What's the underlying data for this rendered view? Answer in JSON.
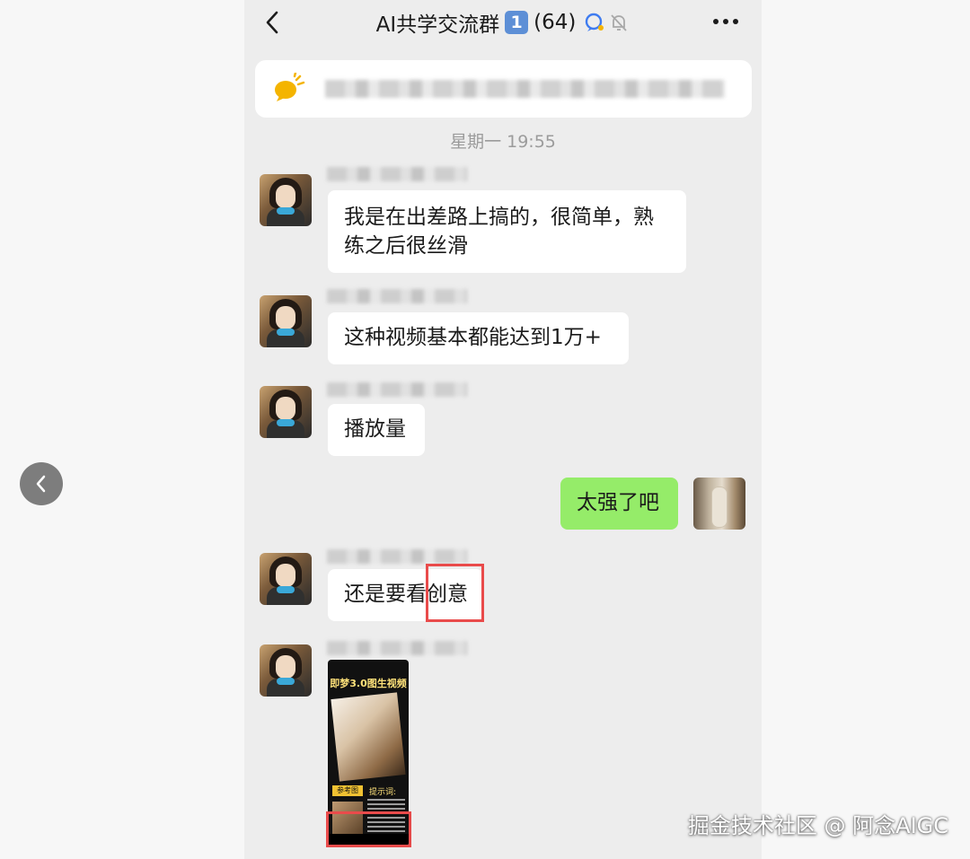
{
  "chat": {
    "title": "AI共学交流群",
    "badge": "1",
    "member_count": "(64)",
    "icons": [
      "back-icon",
      "chat-bubble-icon",
      "mute-bell-icon",
      "more-dots-icon",
      "megaphone-icon",
      "prev-chevron-icon"
    ],
    "timestamp": "星期一 19:55"
  },
  "messages": [
    {
      "side": "left",
      "text": "我是在出差路上搞的，很简单，熟练之后很丝滑"
    },
    {
      "side": "left",
      "text": "这种视频基本都能达到1万+"
    },
    {
      "side": "left",
      "text": "播放量"
    },
    {
      "side": "right",
      "text": "太强了吧"
    },
    {
      "side": "left",
      "text_before": "还是要看",
      "text_marked": "创意"
    },
    {
      "side": "left",
      "type": "video",
      "caption": "即梦3.0图生视频",
      "tag": "参考图",
      "prompt_label": "提示词:"
    }
  ],
  "colors": {
    "outgoing_bubble": "#95ec69",
    "incoming_bubble": "#ffffff",
    "highlight_box": "#e94b4b"
  },
  "watermark": "掘金技术社区 @ 阿念AIGC"
}
